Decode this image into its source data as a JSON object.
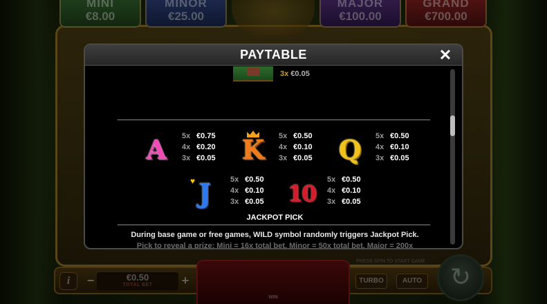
{
  "jackpots": [
    {
      "name": "MINI",
      "value": "€8.00"
    },
    {
      "name": "MINOR",
      "value": "€25.00"
    },
    {
      "name": "MAJOR",
      "value": "€100.00"
    },
    {
      "name": "GRAND",
      "value": "€700.00"
    }
  ],
  "controls": {
    "info_label": "i",
    "minus_label": "−",
    "plus_label": "+",
    "bet_value": "€0.50",
    "bet_label": "TOTAL BET",
    "win_label": "WIN",
    "hint": "PRESS SPIN TO START GAME",
    "turbo_label": "TURBO",
    "auto_label": "AUTO",
    "spin_icon": "↻"
  },
  "modal": {
    "title": "PAYTABLE",
    "close_label": "✕",
    "scroll_position": 0.3
  },
  "house_symbol": {
    "icon": "house-icon",
    "mult": "3x",
    "amount": "€0.05"
  },
  "symbols": [
    {
      "id": "A",
      "pays": [
        {
          "mult": "5x",
          "amount": "€0.75"
        },
        {
          "mult": "4x",
          "amount": "€0.20"
        },
        {
          "mult": "3x",
          "amount": "€0.05"
        }
      ]
    },
    {
      "id": "K",
      "pays": [
        {
          "mult": "5x",
          "amount": "€0.50"
        },
        {
          "mult": "4x",
          "amount": "€0.10"
        },
        {
          "mult": "3x",
          "amount": "€0.05"
        }
      ]
    },
    {
      "id": "Q",
      "pays": [
        {
          "mult": "5x",
          "amount": "€0.50"
        },
        {
          "mult": "4x",
          "amount": "€0.10"
        },
        {
          "mult": "3x",
          "amount": "€0.05"
        }
      ]
    },
    {
      "id": "J",
      "pays": [
        {
          "mult": "5x",
          "amount": "€0.50"
        },
        {
          "mult": "4x",
          "amount": "€0.10"
        },
        {
          "mult": "3x",
          "amount": "€0.05"
        }
      ]
    },
    {
      "id": "10",
      "pays": [
        {
          "mult": "5x",
          "amount": "€0.50"
        },
        {
          "mult": "4x",
          "amount": "€0.10"
        },
        {
          "mult": "3x",
          "amount": "€0.05"
        }
      ]
    }
  ],
  "jackpot_pick": {
    "title": "JACKPOT PICK",
    "line1": "During base game or free games, WILD symbol randomly triggers Jackpot Pick.",
    "line2": "Pick to reveal a prize: Mini = 16x total bet, Minor = 50x total bet, Major = 200x"
  }
}
